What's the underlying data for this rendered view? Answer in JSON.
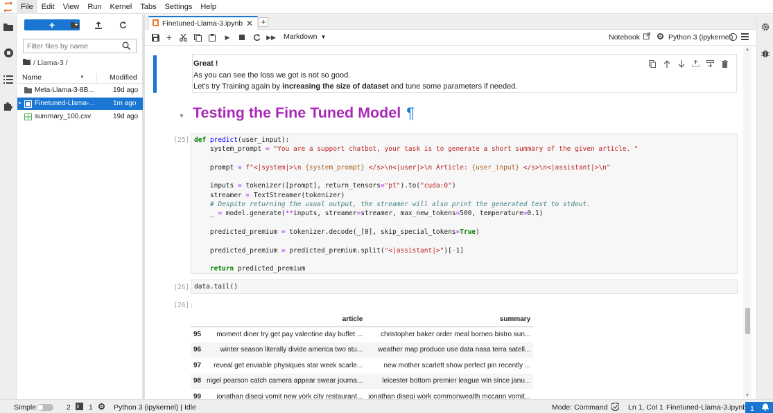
{
  "menubar": {
    "items": [
      "File",
      "Edit",
      "View",
      "Run",
      "Kernel",
      "Tabs",
      "Settings",
      "Help"
    ]
  },
  "filebrowser": {
    "filter_placeholder": "Filter files by name",
    "breadcrumb": "/ Llama-3 /",
    "header": {
      "name": "Name",
      "modified": "Modified"
    },
    "files": [
      {
        "name": "Meta-Llama-3-8B...",
        "modified": "19d ago",
        "type": "folder",
        "selected": false
      },
      {
        "name": "Finetuned-Llama-...",
        "modified": "1m ago",
        "type": "notebook",
        "selected": true
      },
      {
        "name": "summary_100.csv",
        "modified": "19d ago",
        "type": "csv",
        "selected": false
      }
    ]
  },
  "tab": {
    "title": "Finetuned-Llama-3.ipynb"
  },
  "toolbar": {
    "cell_type": "Markdown",
    "notebook_label": "Notebook",
    "kernel_label": "Python 3 (ipykernel)"
  },
  "md_cell": {
    "title": "Great !",
    "line1": "As you can see the loss we got is not so good.",
    "line2_pre": "Let's try Training again by ",
    "line2_bold": "increasing the size of dataset",
    "line2_post": " and tune some parameters if needed."
  },
  "heading": {
    "text": "Testing the Fine Tuned Model",
    "anchor": "¶"
  },
  "cell25": {
    "prompt": "[25]:"
  },
  "cell26": {
    "prompt": "[26]:",
    "code": "data.tail()"
  },
  "out26": {
    "prompt": "[26]:",
    "columns": [
      "",
      "article",
      "summary"
    ],
    "rows": [
      {
        "index": "95",
        "article": "moment diner try get pay valentine day buffet ...",
        "summary": "christopher baker order meal borneo bistro sun..."
      },
      {
        "index": "96",
        "article": "winter season literally divide america two stu...",
        "summary": "weather map produce use data nasa terra satell..."
      },
      {
        "index": "97",
        "article": "reveal get enviable physiques star week scarle...",
        "summary": "new mother scarlett show perfect pin recently ..."
      },
      {
        "index": "98",
        "article": "nigel pearson catch camera appear swear journa...",
        "summary": "leicester bottom premier league win since janu..."
      },
      {
        "index": "99",
        "article": "jonathan disegi vomit new york city restaurant...",
        "summary": "jonathan disegi work commonwealth mccann vomit..."
      }
    ]
  },
  "statusbar": {
    "mode": "Simple",
    "terminals": "2",
    "kernels": "1",
    "kernel_status": "Python 3 (ipykernel) | Idle",
    "command_mode": "Mode: Command",
    "position": "Ln 1, Col 1",
    "filename": "Finetuned-Llama-3.ipynb",
    "badge": "1"
  },
  "colors": {
    "accent": "#1976d2",
    "heading": "#a829b8"
  }
}
